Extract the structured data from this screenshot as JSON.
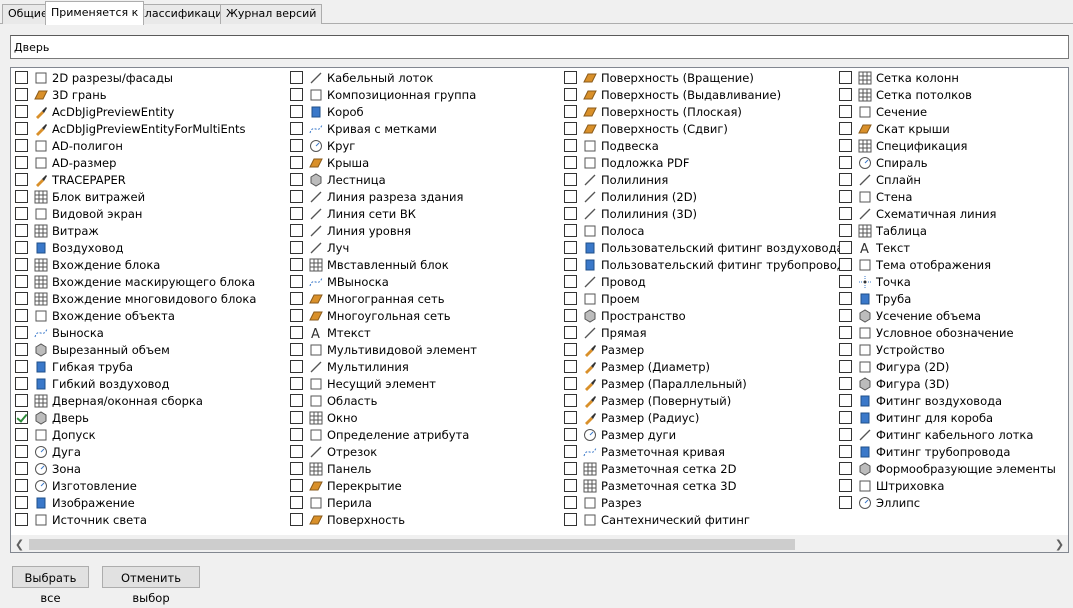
{
  "tabs": [
    "Общие",
    "Применяется к",
    "Классификации",
    "Журнал версий"
  ],
  "active_tab": 1,
  "name_field": {
    "value": "Дверь"
  },
  "columns": [
    [
      {
        "label": "2D разрезы/фасады",
        "icon": "section-elevation-icon"
      },
      {
        "label": "3D грань",
        "icon": "3d-face-icon"
      },
      {
        "label": "AcDbJigPreviewEntity",
        "icon": "brush-icon"
      },
      {
        "label": "AcDbJigPreviewEntityForMultiEnts",
        "icon": "brush-icon"
      },
      {
        "label": "AD-полигон",
        "icon": "polygon-icon"
      },
      {
        "label": "AD-размер",
        "icon": "dimension-icon"
      },
      {
        "label": "TRACEPAPER",
        "icon": "brush-icon"
      },
      {
        "label": "Блок витражей",
        "icon": "curtain-wall-unit-icon"
      },
      {
        "label": "Видовой экран",
        "icon": "viewport-icon"
      },
      {
        "label": "Витраж",
        "icon": "curtain-wall-icon"
      },
      {
        "label": "Воздуховод",
        "icon": "duct-icon"
      },
      {
        "label": "Вхождение блока",
        "icon": "block-reference-icon"
      },
      {
        "label": "Вхождение маскирующего блока",
        "icon": "mask-block-icon"
      },
      {
        "label": "Вхождение многовидового блока",
        "icon": "multiview-block-icon"
      },
      {
        "label": "Вхождение объекта",
        "icon": "object-reference-icon"
      },
      {
        "label": "Выноска",
        "icon": "leader-icon"
      },
      {
        "label": "Вырезанный объем",
        "icon": "cut-volume-icon"
      },
      {
        "label": "Гибкая труба",
        "icon": "flex-pipe-icon"
      },
      {
        "label": "Гибкий воздуховод",
        "icon": "flex-duct-icon"
      },
      {
        "label": "Дверная/оконная сборка",
        "icon": "door-window-assembly-icon"
      },
      {
        "label": "Дверь",
        "icon": "door-icon",
        "checked": true
      },
      {
        "label": "Допуск",
        "icon": "tolerance-icon"
      },
      {
        "label": "Дуга",
        "icon": "arc-icon"
      },
      {
        "label": "Зона",
        "icon": "zone-icon"
      },
      {
        "label": "Изготовление",
        "icon": "fabrication-icon"
      },
      {
        "label": "Изображение",
        "icon": "image-icon"
      },
      {
        "label": "Источник света",
        "icon": "light-icon"
      }
    ],
    [
      {
        "label": "Кабельный лоток",
        "icon": "cable-tray-icon"
      },
      {
        "label": "Композиционная группа",
        "icon": "composition-group-icon"
      },
      {
        "label": "Короб",
        "icon": "conduit-icon"
      },
      {
        "label": "Кривая с метками",
        "icon": "marked-curve-icon"
      },
      {
        "label": "Круг",
        "icon": "circle-icon"
      },
      {
        "label": "Крыша",
        "icon": "roof-icon"
      },
      {
        "label": "Лестница",
        "icon": "stair-icon"
      },
      {
        "label": "Линия разреза здания",
        "icon": "section-line-icon"
      },
      {
        "label": "Линия сети ВК",
        "icon": "network-line-icon"
      },
      {
        "label": "Линия уровня",
        "icon": "level-line-icon"
      },
      {
        "label": "Луч",
        "icon": "ray-icon"
      },
      {
        "label": "Мвставленный блок",
        "icon": "minsert-block-icon"
      },
      {
        "label": "МВыноска",
        "icon": "mleader-icon"
      },
      {
        "label": "Многогранная сеть",
        "icon": "polyface-mesh-icon"
      },
      {
        "label": "Многоугольная сеть",
        "icon": "polygon-mesh-icon"
      },
      {
        "label": "Мтекст",
        "icon": "mtext-icon"
      },
      {
        "label": "Мультивидовой элемент",
        "icon": "multiview-element-icon"
      },
      {
        "label": "Мультилиния",
        "icon": "mline-icon"
      },
      {
        "label": "Несущий элемент",
        "icon": "structural-member-icon"
      },
      {
        "label": "Область",
        "icon": "region-icon"
      },
      {
        "label": "Окно",
        "icon": "window-icon"
      },
      {
        "label": "Определение атрибута",
        "icon": "attribute-definition-icon"
      },
      {
        "label": "Отрезок",
        "icon": "line-icon"
      },
      {
        "label": "Панель",
        "icon": "panel-icon"
      },
      {
        "label": "Перекрытие",
        "icon": "slab-icon"
      },
      {
        "label": "Перила",
        "icon": "railing-icon"
      },
      {
        "label": "Поверхность",
        "icon": "surface-icon"
      }
    ],
    [
      {
        "label": "Поверхность (Вращение)",
        "icon": "surface-revolve-icon"
      },
      {
        "label": "Поверхность (Выдавливание)",
        "icon": "surface-extrude-icon"
      },
      {
        "label": "Поверхность (Плоская)",
        "icon": "surface-planar-icon"
      },
      {
        "label": "Поверхность (Сдвиг)",
        "icon": "surface-sweep-icon"
      },
      {
        "label": "Подвеска",
        "icon": "hanger-icon"
      },
      {
        "label": "Подложка PDF",
        "icon": "pdf-underlay-icon"
      },
      {
        "label": "Полилиния",
        "icon": "polyline-icon"
      },
      {
        "label": "Полилиния (2D)",
        "icon": "polyline-2d-icon"
      },
      {
        "label": "Полилиния (3D)",
        "icon": "polyline-3d-icon"
      },
      {
        "label": "Полоса",
        "icon": "trace-icon"
      },
      {
        "label": "Пользовательский фитинг воздуховода",
        "icon": "custom-duct-fitting-icon"
      },
      {
        "label": "Пользовательский фитинг трубопровода",
        "icon": "custom-pipe-fitting-icon"
      },
      {
        "label": "Провод",
        "icon": "wire-icon"
      },
      {
        "label": "Проем",
        "icon": "opening-icon"
      },
      {
        "label": "Пространство",
        "icon": "space-icon"
      },
      {
        "label": "Прямая",
        "icon": "xline-icon"
      },
      {
        "label": "Размер",
        "icon": "dimension-brush-icon"
      },
      {
        "label": "Размер (Диаметр)",
        "icon": "dimension-brush-icon"
      },
      {
        "label": "Размер (Параллельный)",
        "icon": "dimension-brush-icon"
      },
      {
        "label": "Размер (Повернутый)",
        "icon": "dimension-brush-icon"
      },
      {
        "label": "Размер (Радиус)",
        "icon": "dimension-brush-icon"
      },
      {
        "label": "Размер дуги",
        "icon": "arc-dimension-icon"
      },
      {
        "label": "Разметочная кривая",
        "icon": "layout-curve-icon"
      },
      {
        "label": "Разметочная сетка 2D",
        "icon": "layout-grid-2d-icon"
      },
      {
        "label": "Разметочная сетка 3D",
        "icon": "layout-grid-3d-icon"
      },
      {
        "label": "Разрез",
        "icon": "section-icon"
      },
      {
        "label": "Сантехнический фитинг",
        "icon": "plumbing-fitting-icon"
      }
    ],
    [
      {
        "label": "Сетка колонн",
        "icon": "column-grid-icon"
      },
      {
        "label": "Сетка потолков",
        "icon": "ceiling-grid-icon"
      },
      {
        "label": "Сечение",
        "icon": "sectioning-icon"
      },
      {
        "label": "Скат крыши",
        "icon": "roof-slab-icon"
      },
      {
        "label": "Спецификация",
        "icon": "schedule-icon"
      },
      {
        "label": "Спираль",
        "icon": "helix-icon"
      },
      {
        "label": "Сплайн",
        "icon": "spline-icon"
      },
      {
        "label": "Стена",
        "icon": "wall-icon"
      },
      {
        "label": "Схематичная линия",
        "icon": "schematic-line-icon"
      },
      {
        "label": "Таблица",
        "icon": "table-icon"
      },
      {
        "label": "Текст",
        "icon": "text-icon"
      },
      {
        "label": "Тема отображения",
        "icon": "display-theme-icon"
      },
      {
        "label": "Точка",
        "icon": "point-icon"
      },
      {
        "label": "Труба",
        "icon": "pipe-icon"
      },
      {
        "label": "Усечение объема",
        "icon": "volume-clip-icon"
      },
      {
        "label": "Условное обозначение",
        "icon": "symbol-icon"
      },
      {
        "label": "Устройство",
        "icon": "device-icon"
      },
      {
        "label": "Фигура (2D)",
        "icon": "shape-2d-icon"
      },
      {
        "label": "Фигура (3D)",
        "icon": "shape-3d-icon"
      },
      {
        "label": "Фитинг воздуховода",
        "icon": "duct-fitting-icon"
      },
      {
        "label": "Фитинг для короба",
        "icon": "conduit-fitting-icon"
      },
      {
        "label": "Фитинг кабельного лотка",
        "icon": "cable-tray-fitting-icon"
      },
      {
        "label": "Фитинг трубопровода",
        "icon": "pipe-fitting-icon"
      },
      {
        "label": "Формообразующие элементы",
        "icon": "mass-element-icon"
      },
      {
        "label": "Штриховка",
        "icon": "hatch-icon"
      },
      {
        "label": "Эллипс",
        "icon": "ellipse-icon"
      }
    ]
  ],
  "buttons": {
    "select_all": "Выбрать все",
    "deselect": "Отменить выбор"
  },
  "colors": {
    "check": "#2e8b3a",
    "accent_blue": "#3a78c9",
    "accent_orange": "#d9902a"
  }
}
